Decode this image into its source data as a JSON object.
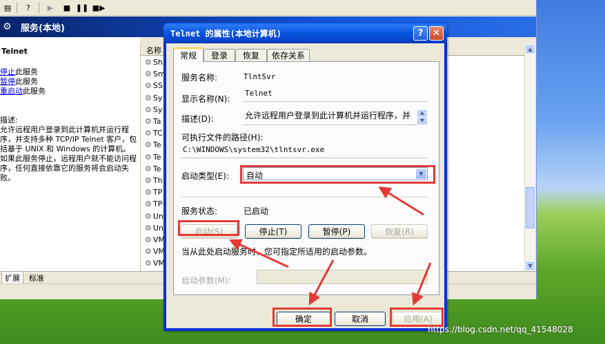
{
  "mmc": {
    "banner_title": "服务(本地)",
    "left_title": "Telnet",
    "links": [
      {
        "link": "停止",
        "suffix": "此服务"
      },
      {
        "link": "暂停",
        "suffix": "此服务"
      },
      {
        "link": "重启动",
        "suffix": "此服务"
      }
    ],
    "desc_label": "描述:",
    "desc_text": "允许远程用户登录到此计算机并运行程序，并支持多种 TCP/IP Telnet 客户，包括基于 UNIX 和 Windows 的计算机。如果此服务停止，远程用户就不能访问程序，任何直接依靠它的服务将会启动失败。",
    "list_header": "名称",
    "rows": [
      "Sh",
      "Sm",
      "SS",
      "Sy",
      "Sy",
      "Ta",
      "TC",
      "Te",
      "Te",
      "Te",
      "Th",
      "TP",
      "TP",
      "Un",
      "Un",
      "VM",
      "VM",
      "VM"
    ],
    "bottom_tabs": [
      "扩展",
      "标准"
    ]
  },
  "dialog": {
    "title": "Telnet 的属性(本地计算机)",
    "help_label": "?",
    "close_label": "✕",
    "tabs": [
      "常规",
      "登录",
      "恢复",
      "依存关系"
    ],
    "service_name_label": "服务名称:",
    "service_name_value": "TlntSvr",
    "display_name_label": "显示名称(N):",
    "display_name_value": "Telnet",
    "description_label": "描述(D):",
    "description_value": "允许远程用户登录到此计算机并运行程序，并",
    "exe_path_label": "可执行文件的路径(H):",
    "exe_path_value": "C:\\WINDOWS\\system32\\tlntsvr.exe",
    "startup_type_label": "启动类型(E):",
    "startup_type_value": "自动",
    "status_label": "服务状态:",
    "status_value": "已启动",
    "start_button": "启动(S)",
    "stop_button": "停止(T)",
    "pause_button": "暂停(P)",
    "resume_button": "恢复(R)",
    "hint_text": "当从此处启动服务时，您可指定所适用的启动参数。",
    "start_params_label": "启动参数(M):",
    "ok_button": "确定",
    "cancel_button": "取消",
    "apply_button": "应用(A)"
  },
  "colors": {
    "highlight_box": "#e53935",
    "title_blue": "#0a54e0"
  },
  "watermark": "https://blog.csdn.net/qq_41548028"
}
